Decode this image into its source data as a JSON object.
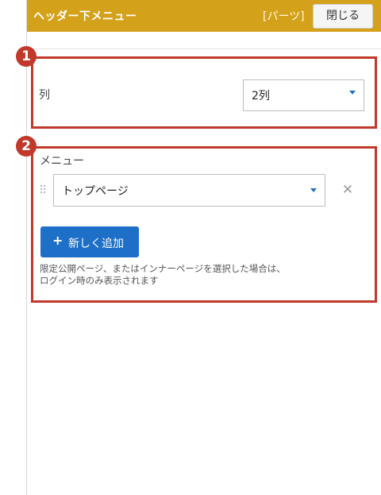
{
  "header": {
    "title": "ヘッダー下メニュー",
    "tag": "[パーツ]",
    "close_label": "閉じる",
    "bg_color": "#d4a11a"
  },
  "annotations": {
    "badge1": "1",
    "badge2": "2",
    "highlight_color": "#c0392b"
  },
  "columns": {
    "label": "列",
    "selected": "2列"
  },
  "menu": {
    "label": "メニュー",
    "items": [
      {
        "selected": "トップページ"
      }
    ],
    "add_label": "新しく追加",
    "note_line1": "限定公開ページ、またはインナーページを選択した場合は、",
    "note_line2": "ログイン時のみ表示されます"
  },
  "icons": {
    "drag": "drag-handle-icon",
    "remove": "close-x-icon",
    "plus": "plus-icon",
    "caret": "caret-down-icon"
  }
}
